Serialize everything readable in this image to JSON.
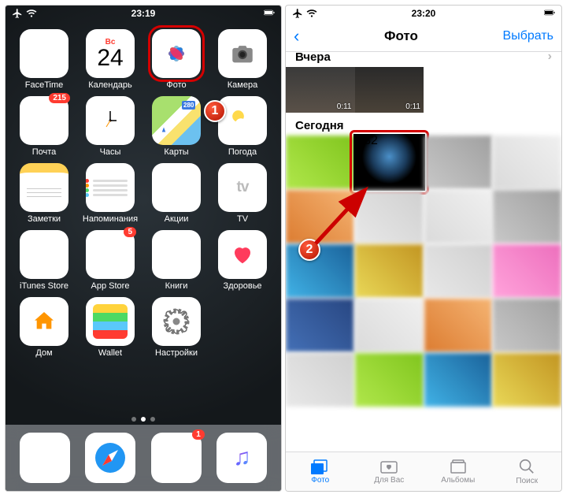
{
  "left": {
    "time": "23:19",
    "apps": {
      "facetime": "FaceTime",
      "calendar": "Календарь",
      "cal_dow": "Вс",
      "cal_day": "24",
      "photos": "Фото",
      "camera": "Камера",
      "mail": "Почта",
      "mail_badge": "215",
      "clock": "Часы",
      "maps": "Карты",
      "weather": "Погода",
      "notes": "Заметки",
      "reminders": "Напоминания",
      "stocks": "Акции",
      "tv": "TV",
      "itunes": "iTunes Store",
      "appstore": "App Store",
      "appstore_badge": "5",
      "books": "Книги",
      "health": "Здоровье",
      "home": "Дом",
      "wallet": "Wallet",
      "settings": "Настройки",
      "tv_icon": "🅐tv"
    },
    "dock": {
      "messages_badge": "1"
    },
    "callout": "1"
  },
  "right": {
    "time": "23:20",
    "nav": {
      "title": "Фото",
      "select": "Выбрать"
    },
    "sections": {
      "yesterday": "Вчера",
      "today": "Сегодня"
    },
    "yesterday_thumbs": [
      {
        "duration": "0:11"
      },
      {
        "duration": "0:11"
      }
    ],
    "featured": {
      "duration": "0:32"
    },
    "tabs": {
      "photos": "Фото",
      "foryou": "Для Вас",
      "albums": "Альбомы",
      "search": "Поиск"
    },
    "callout": "2"
  }
}
